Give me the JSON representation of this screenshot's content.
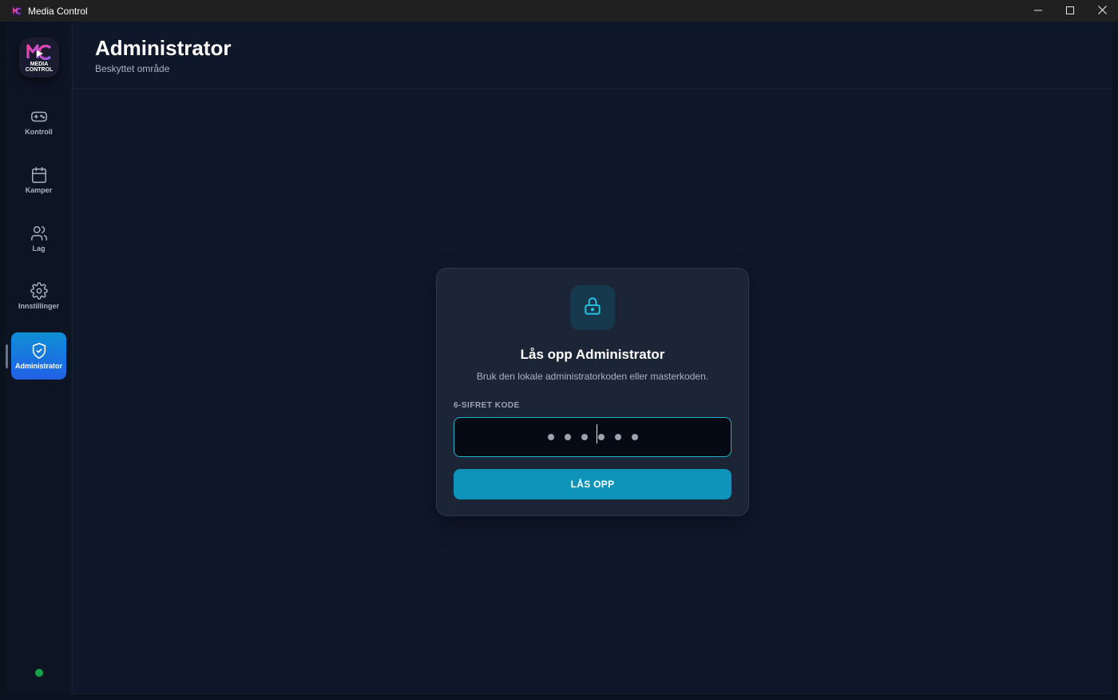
{
  "window": {
    "title": "Media Control",
    "controls": [
      "minimize-icon",
      "maximize-icon",
      "close-icon"
    ]
  },
  "sidebar": {
    "logo": {
      "line1": "MEDIA",
      "line2": "CONTROL",
      "monogram": "MC"
    },
    "items": [
      {
        "label": "Kontroll",
        "icon": "gamepad-icon",
        "active": false
      },
      {
        "label": "Kamper",
        "icon": "calendar-icon",
        "active": false
      },
      {
        "label": "Lag",
        "icon": "users-icon",
        "active": false
      },
      {
        "label": "Innstillinger",
        "icon": "gear-icon",
        "active": false
      },
      {
        "label": "Administrator",
        "icon": "shield-check-icon",
        "active": true
      }
    ],
    "status_color": "#16a34a"
  },
  "header": {
    "title": "Administrator",
    "subtitle": "Beskyttet område"
  },
  "unlock_card": {
    "icon": "lock-icon",
    "title": "Lås opp Administrator",
    "description": "Bruk den lokale administratorkoden eller masterkoden.",
    "field_label": "6-SIFRET KODE",
    "code_length": 6,
    "button_label": "LÅS OPP"
  },
  "colors": {
    "accent": "#0e93ba",
    "active_nav": "#1f6fe0",
    "input_border": "#22b4cf",
    "background": "#0f172a"
  }
}
